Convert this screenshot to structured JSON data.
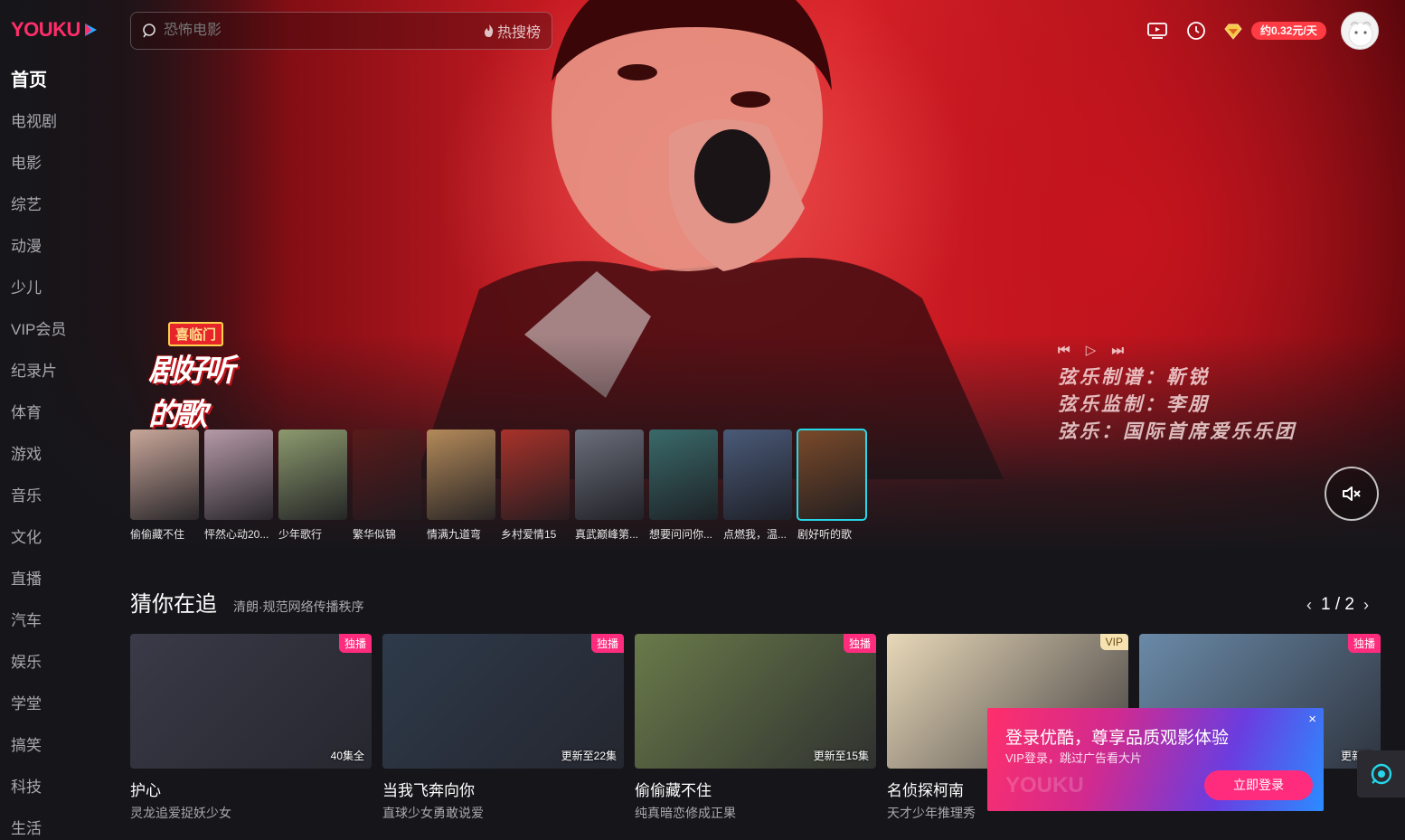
{
  "topbar": {
    "logo_text": "YOUKU",
    "search_placeholder": "恐怖电影",
    "hot_label": "热搜榜",
    "vip_price": "约0.32元/天"
  },
  "sidebar": {
    "items": [
      {
        "label": "首页"
      },
      {
        "label": "电视剧"
      },
      {
        "label": "电影"
      },
      {
        "label": "综艺"
      },
      {
        "label": "动漫"
      },
      {
        "label": "少儿"
      },
      {
        "label": "VIP会员"
      },
      {
        "label": "纪录片"
      },
      {
        "label": "体育"
      },
      {
        "label": "游戏"
      },
      {
        "label": "音乐"
      },
      {
        "label": "文化"
      },
      {
        "label": "直播"
      },
      {
        "label": "汽车"
      },
      {
        "label": "娱乐"
      },
      {
        "label": "学堂"
      },
      {
        "label": "搞笑"
      },
      {
        "label": "科技"
      },
      {
        "label": "生活"
      }
    ]
  },
  "hero": {
    "show_brand": "喜临门",
    "show_name": "剧好听的歌",
    "credits": [
      "弦乐制谱：靳锐",
      "弦乐监制：李朋",
      "弦乐：国际首席爱乐乐团"
    ]
  },
  "thumbs": [
    {
      "caption": "偷偷藏不住",
      "color": "#c9a79a"
    },
    {
      "caption": "怦然心动20...",
      "color": "#b69aa8"
    },
    {
      "caption": "少年歌行",
      "color": "#8c9a6e"
    },
    {
      "caption": "繁华似锦",
      "color": "#5a1a1a"
    },
    {
      "caption": "情满九道弯",
      "color": "#b48a5a"
    },
    {
      "caption": "乡村爱情15",
      "color": "#a8322a"
    },
    {
      "caption": "真武巅峰第...",
      "color": "#6a6e7a"
    },
    {
      "caption": "想要问问你...",
      "color": "#3a6a6a"
    },
    {
      "caption": "点燃我，温...",
      "color": "#4a5a78"
    },
    {
      "caption": "剧好听的歌",
      "color": "#7a4a2a"
    }
  ],
  "section": {
    "title": "猜你在追",
    "subtitle": "清朗·规范网络传播秩序",
    "pager": "1 / 2"
  },
  "cards": [
    {
      "title": "护心",
      "desc": "灵龙追爱捉妖少女",
      "badge": "独播",
      "ep": "40集全",
      "color": "#3a3a48"
    },
    {
      "title": "当我飞奔向你",
      "desc": "直球少女勇敢说爱",
      "badge": "独播",
      "ep": "更新至22集",
      "color": "#2e3a4a"
    },
    {
      "title": "偷偷藏不住",
      "desc": "纯真暗恋修成正果",
      "badge": "独播",
      "ep": "更新至15集",
      "color": "#6a7a4a"
    },
    {
      "title": "名侦探柯南",
      "desc": "天才少年推理秀",
      "badge": "VIP",
      "ep": "",
      "color": "#e8d8b8"
    },
    {
      "title": "",
      "desc": "",
      "badge": "独播",
      "ep": "更新至",
      "color": "#6a8aa8"
    }
  ],
  "login_popup": {
    "heading": "登录优酷，尊享品质观影体验",
    "sub": "VIP登录，跳过广告看大片",
    "button": "立即登录",
    "close": "×",
    "watermark": "YOUKU"
  },
  "colors": {
    "accent_pink": "#ff2c7e",
    "accent_cyan": "#25d7e8",
    "bg": "#16161a"
  }
}
